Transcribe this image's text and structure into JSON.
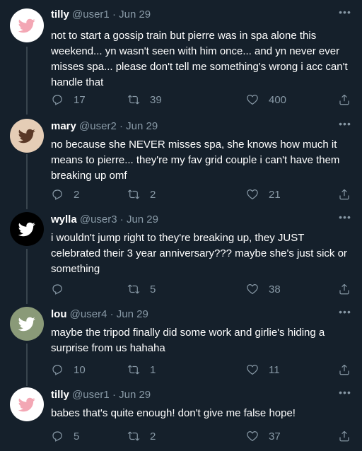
{
  "colors": {
    "background": "#15202b",
    "secondary_text": "#8899a6",
    "thread_line": "#38444d"
  },
  "tweets": [
    {
      "name": "tilly",
      "handle": "@user1",
      "sep": "·",
      "date": "Jun 29",
      "avatar_bg": "#ffffff",
      "avatar_icon_color": "#f3a7b4",
      "avatar_icon": "bird-icon",
      "text": "not to start a gossip train but pierre was in spa alone this weekend... yn wasn't seen with him once... and yn never ever misses spa... please don't tell me something's wrong i acc can't handle that",
      "replies": "17",
      "retweets": "39",
      "likes": "400"
    },
    {
      "name": "mary",
      "handle": "@user2",
      "sep": "·",
      "date": "Jun 29",
      "avatar_bg": "#e5cdb6",
      "avatar_icon_color": "#5a3826",
      "avatar_icon": "bird-icon",
      "text": "no because she NEVER misses spa, she knows how much it means to pierre... they're my fav grid couple i can't have them breaking up omf",
      "replies": "2",
      "retweets": "2",
      "likes": "21"
    },
    {
      "name": "wylla",
      "handle": "@user3",
      "sep": "·",
      "date": "Jun 29",
      "avatar_bg": "#000000",
      "avatar_icon_color": "#ffffff",
      "avatar_icon": "bird-icon",
      "text": "i wouldn't jump right to they're breaking up, they JUST celebrated their 3 year anniversary??? maybe she's just sick or something",
      "replies": "",
      "retweets": "5",
      "likes": "38"
    },
    {
      "name": "lou",
      "handle": "@user4",
      "sep": "·",
      "date": "Jun 29",
      "avatar_bg": "#8a9a78",
      "avatar_icon_color": "#ffffff",
      "avatar_icon": "bird-icon",
      "text": "maybe the tripod finally did some work and girlie's hiding a surprise from us hahaha",
      "replies": "10",
      "retweets": "1",
      "likes": "11"
    },
    {
      "name": "tilly",
      "handle": "@user1",
      "sep": "·",
      "date": "Jun 29",
      "avatar_bg": "#ffffff",
      "avatar_icon_color": "#f3a7b4",
      "avatar_icon": "bird-icon",
      "text": "babes that's quite enough! don't give me false hope!",
      "replies": "5",
      "retweets": "2",
      "likes": "37"
    }
  ]
}
